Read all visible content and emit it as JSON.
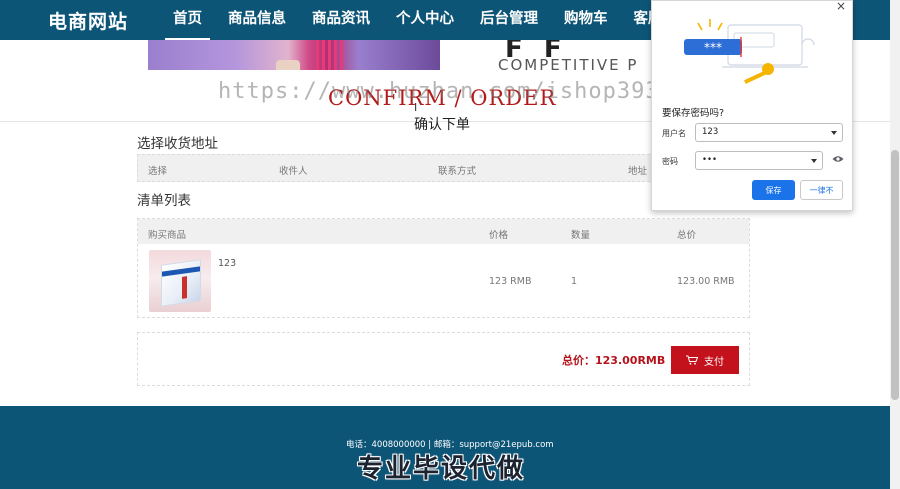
{
  "nav": {
    "brand": "电商网站",
    "links": [
      "首页",
      "商品信息",
      "商品资讯",
      "个人中心",
      "后台管理",
      "购物车",
      "客服"
    ]
  },
  "banner": {
    "text": "COMPETITIVE P",
    "glyphs": "F F"
  },
  "page": {
    "title_en": "CONFIRM / ORDER",
    "title_cn": "确认下单",
    "watermark_url": "https://www.huzhan.com/ishop39397"
  },
  "address": {
    "title": "选择收货地址",
    "headers": [
      "选择",
      "收件人",
      "联系方式",
      "地址"
    ]
  },
  "cart": {
    "title": "清单列表",
    "headers": [
      "购买商品",
      "价格",
      "数量",
      "总价"
    ],
    "items": [
      {
        "name": "123",
        "price": "123 RMB",
        "qty": "1",
        "total": "123.00 RMB"
      }
    ]
  },
  "total": {
    "label": "总价：123.00RMB",
    "pay_label": "支付"
  },
  "footer": {
    "contact": "电话：4008000000 | 邮箱：support@21epub.com",
    "slogan": "专业毕设代做"
  },
  "password_popup": {
    "question": "要保存密码吗?",
    "username_label": "用户名",
    "username_value": "123",
    "password_label": "密码",
    "password_value": "•••",
    "illus_text": "***",
    "save_label": "保存",
    "never_label": "一律不",
    "close": "×"
  },
  "colors": {
    "nav_bg": "#0d5577",
    "accent_red": "#c4121d",
    "title_red": "#b11b1b",
    "save_blue": "#1a73e8"
  }
}
